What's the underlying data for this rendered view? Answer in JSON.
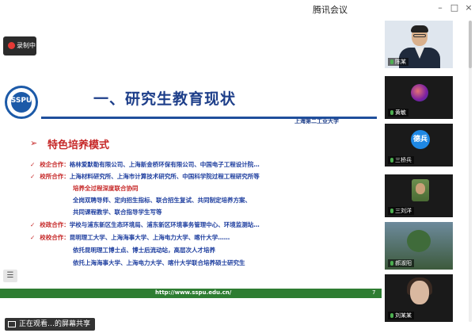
{
  "app": {
    "window_title": "腾讯会议",
    "recording_label": "录制中",
    "share_label": "正在观看…的屏幕共享"
  },
  "slide": {
    "title": "一、研究生教育现状",
    "university": "上海第二工业大学",
    "logo_text": "SSPU",
    "section_title": "特色培养模式",
    "bullets": [
      {
        "label": "校企合作：",
        "text": "格林爱默勒有限公司、上海新金桥环保有限公司、中国电子工程设计院…"
      },
      {
        "label": "校所合作：",
        "text": "上海材料研究所、上海市计算技术研究所、中国科学院过程工程研究所等"
      }
    ],
    "sublines_1": [
      {
        "text": "培养全过程深度联合协同",
        "color": "red"
      },
      {
        "text": "全岗双聘导师、定向招生指标、联合招生复试、共同制定培养方案、",
        "color": "blue"
      },
      {
        "text": "共同课程教学、联合指导学生写等",
        "color": "blue"
      }
    ],
    "bullets_2": [
      {
        "label": "校政合作：",
        "text": "学校与浦东新区生态环境局、浦东新区环境事务管理中心、环境监测站…"
      },
      {
        "label": "校校合作：",
        "text": "昆明理工大学、上海海事大学、上海电力大学、喀什大学……"
      }
    ],
    "sublines_2": [
      {
        "text": "依托昆明理工博士点、博士后流动站，高层次人才培养",
        "red_part": "博士点、博士后流动站",
        "color": "mixed"
      },
      {
        "text": "依托上海海事大学、上海电力大学、喀什大学联合培养硕士研究生",
        "color": "mixed"
      }
    ],
    "footer_url": "http://www.sspu.edu.cn/",
    "page_number": "7"
  },
  "participants": [
    {
      "name": "陈某"
    },
    {
      "name": "黄敏"
    },
    {
      "name": "三桥兵",
      "avatar_text": "德兵"
    },
    {
      "name": "三刘洋"
    },
    {
      "name": "郝淑阳"
    },
    {
      "name": "刘某某"
    }
  ],
  "colors": {
    "title_blue": "#1e3f8a",
    "accent_red": "#c62828",
    "footer_green": "#2e7d32",
    "body_blue": "#2040a0"
  }
}
